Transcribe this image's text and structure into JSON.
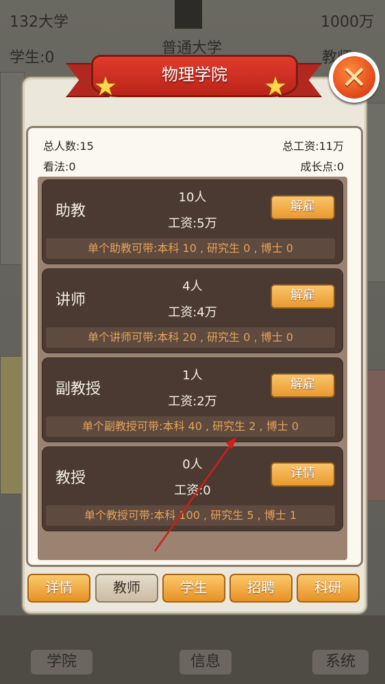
{
  "background": {
    "student_count": "132大学",
    "money": "1000万",
    "university_type": "普通大学",
    "students_label": "学生:0",
    "teachers_label": "教师",
    "bottom_buttons": [
      "学院",
      "信息",
      "系统"
    ]
  },
  "dialog": {
    "title": "物理学院",
    "stats": {
      "total_people": "总人数:15",
      "total_salary": "总工资:11万",
      "opinion": "看法:0",
      "growth_points": "成长点:0"
    },
    "staff": [
      {
        "title": "助教",
        "count": "10人",
        "salary": "工资:5万",
        "button": "解雇",
        "note": "单个助教可带:本科 10 , 研究生 0 , 博士 0"
      },
      {
        "title": "讲师",
        "count": "4人",
        "salary": "工资:4万",
        "button": "解雇",
        "note": "单个讲师可带:本科 20 , 研究生 0 , 博士 0"
      },
      {
        "title": "副教授",
        "count": "1人",
        "salary": "工资:2万",
        "button": "解雇",
        "note": "单个副教授可带:本科 40 , 研究生 2 , 博士 0"
      },
      {
        "title": "教授",
        "count": "0人",
        "salary": "工资:0",
        "button": "详情",
        "note": "单个教授可带:本科 100 , 研究生 5 , 博士 1"
      }
    ],
    "tabs": [
      "详情",
      "教师",
      "学生",
      "招聘",
      "科研"
    ],
    "active_tab": "教师"
  },
  "icons": {
    "close": "close-x-icon",
    "stars": "star-icon"
  },
  "colors": {
    "ribbon": "#d2301f",
    "button": "#f0a83f",
    "card": "#4a3a32",
    "note_text": "#e8a35a"
  }
}
